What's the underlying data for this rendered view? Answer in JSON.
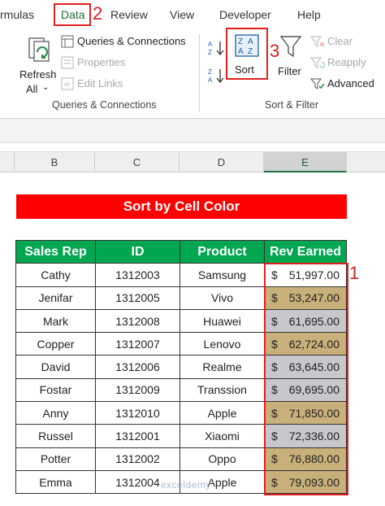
{
  "tabs": {
    "formulas": "rmulas",
    "data": "Data",
    "review": "Review",
    "view": "View",
    "developer": "Developer",
    "help": "Help"
  },
  "steps": {
    "step1": "1",
    "step2": "2",
    "step3": "3"
  },
  "ribbon": {
    "refresh_line1": "Refresh",
    "refresh_line2": "All",
    "queries_connections": "Queries & Connections",
    "properties": "Properties",
    "edit_links": "Edit Links",
    "group_queries": "Queries & Connections",
    "sort": "Sort",
    "filter": "Filter",
    "clear": "Clear",
    "reapply": "Reapply",
    "advanced": "Advanced",
    "group_sort_filter": "Sort & Filter"
  },
  "columns": [
    "B",
    "C",
    "D",
    "E"
  ],
  "sheet": {
    "title": "Sort by Cell Color",
    "headers": [
      "Sales Rep",
      "ID",
      "Product",
      "Rev Earned"
    ],
    "rows": [
      {
        "rep": "Cathy",
        "id": "1312003",
        "product": "Samsung",
        "cur": "$",
        "rev": "51,997.00",
        "color": "#ffffff"
      },
      {
        "rep": "Jenifar",
        "id": "1312005",
        "product": "Vivo",
        "cur": "$",
        "rev": "53,247.00",
        "color": "#c9b07a"
      },
      {
        "rep": "Mark",
        "id": "1312008",
        "product": "Huawei",
        "cur": "$",
        "rev": "61,695.00",
        "color": "#c7c7cc"
      },
      {
        "rep": "Copper",
        "id": "1312007",
        "product": "Lenovo",
        "cur": "$",
        "rev": "62,724.00",
        "color": "#c9b07a"
      },
      {
        "rep": "David",
        "id": "1312006",
        "product": "Realme",
        "cur": "$",
        "rev": "63,645.00",
        "color": "#c7c7cc"
      },
      {
        "rep": "Fostar",
        "id": "1312009",
        "product": "Transsion",
        "cur": "$",
        "rev": "69,695.00",
        "color": "#c7c7cc"
      },
      {
        "rep": "Anny",
        "id": "1312010",
        "product": "Apple",
        "cur": "$",
        "rev": "71,850.00",
        "color": "#c9b07a"
      },
      {
        "rep": "Russel",
        "id": "1312001",
        "product": "Xiaomi",
        "cur": "$",
        "rev": "72,336.00",
        "color": "#c7c7cc"
      },
      {
        "rep": "Potter",
        "id": "1312002",
        "product": "Oppo",
        "cur": "$",
        "rev": "76,880.00",
        "color": "#c9b07a"
      },
      {
        "rep": "Emma",
        "id": "1312004",
        "product": "Apple",
        "cur": "$",
        "rev": "79,093.00",
        "color": "#c9b07a"
      }
    ]
  },
  "watermark": "exceldemy",
  "colors": {
    "title_bg": "#ff0000",
    "header_bg": "#00a650",
    "highlight": "#e02020",
    "excel_green": "#217346"
  }
}
